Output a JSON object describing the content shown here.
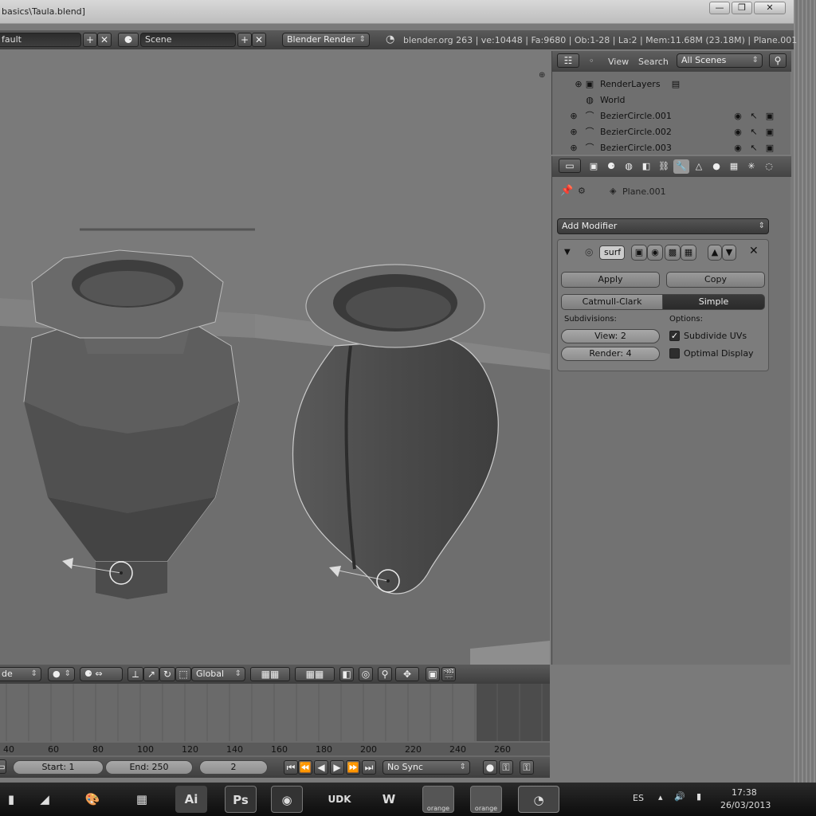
{
  "window": {
    "title": "basics\\Taula.blend]"
  },
  "info_header": {
    "layout": "fault",
    "scene": "Scene",
    "render_engine": "Blender Render",
    "stats": "blender.org 263 | ve:10448 | Fa:9680 | Ob:1-28 | La:2 | Mem:11.68M (23.18M) | Plane.001"
  },
  "outliner": {
    "view_label": "View",
    "search_label": "Search",
    "scenes_select": "All Scenes",
    "rows": [
      {
        "label": "RenderLayers",
        "icon": "render-layers-icon"
      },
      {
        "label": "World",
        "icon": "world-icon"
      },
      {
        "label": "BezierCircle.001",
        "icon": "curve-icon"
      },
      {
        "label": "BezierCircle.002",
        "icon": "curve-icon"
      },
      {
        "label": "BezierCircle.003",
        "icon": "curve-icon"
      }
    ]
  },
  "properties": {
    "object_name": "Plane.001",
    "add_modifier": "Add Modifier",
    "modifier": {
      "name": "surf",
      "apply": "Apply",
      "copy": "Copy",
      "type_a": "Catmull-Clark",
      "type_b": "Simple",
      "subdivisions_label": "Subdivisions:",
      "options_label": "Options:",
      "view": "View: 2",
      "render": "Render: 4",
      "subdivide_uvs": "Subdivide UVs",
      "subdivide_uvs_checked": true,
      "optimal_display": "Optimal Display",
      "optimal_display_checked": false
    }
  },
  "viewport_header": {
    "mode": "de",
    "orientation": "Global"
  },
  "timeline": {
    "ticks": [
      "40",
      "60",
      "80",
      "100",
      "120",
      "140",
      "160",
      "180",
      "200",
      "220",
      "240",
      "260"
    ],
    "start": "Start: 1",
    "end": "End: 250",
    "current": "2",
    "sync": "No Sync"
  },
  "taskbar": {
    "items": [
      "photo-app-icon",
      "paint-icon",
      "calculator-icon",
      "illustrator-icon",
      "photoshop-icon",
      "firefox-icon",
      "udk-icon",
      "word-icon",
      "orange-icon",
      "orange-icon",
      "blender-icon"
    ],
    "ai_label": "Ai",
    "ps_label": "Ps",
    "udk_label": "UDK",
    "orange_label": "orange",
    "lang": "ES",
    "time": "17:38",
    "date": "26/03/2013"
  }
}
